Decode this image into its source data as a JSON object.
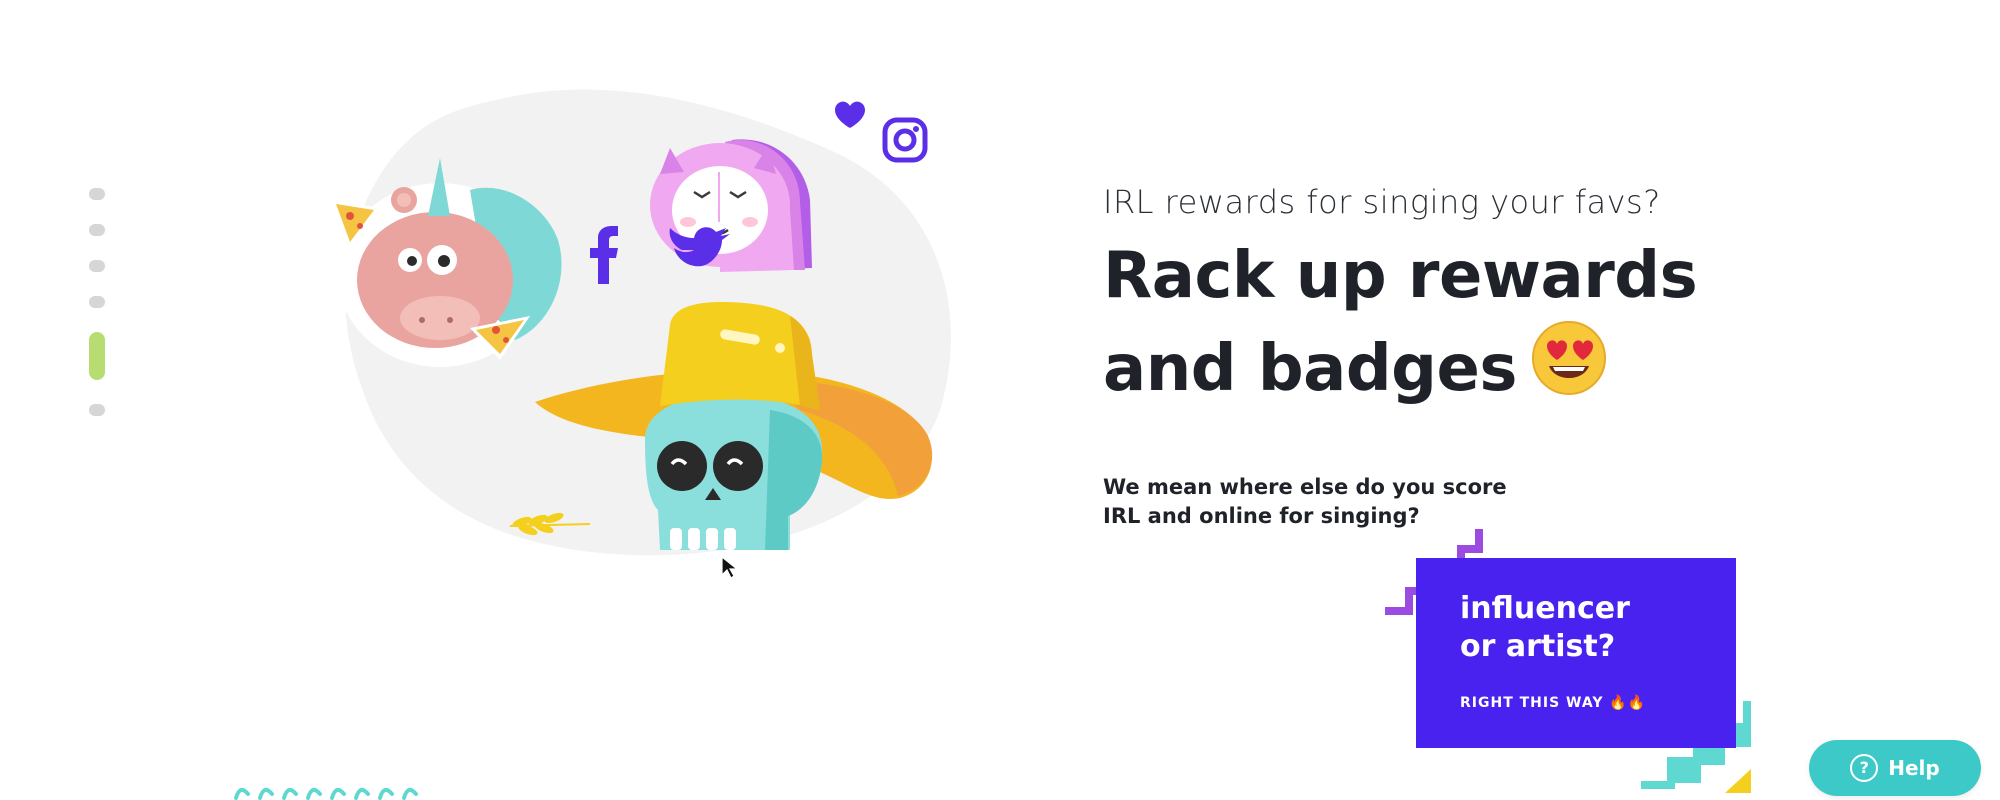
{
  "hero": {
    "kicker": "IRL rewards for singing your favs?",
    "headline_line1": "Rack up rewards",
    "headline_line2": "and badges",
    "headline_emoji": "heart-eyes-emoji",
    "body_line1": "We mean where else do you score",
    "body_line2": "IRL and online for singing?"
  },
  "slide_nav": {
    "count": 6,
    "active_index": 4
  },
  "cta": {
    "title_line1": "influencer",
    "title_line2": "or artist?",
    "link_label": "RIGHT THIS WAY 🔥🔥"
  },
  "help": {
    "label": "Help",
    "icon": "?"
  },
  "illustration": {
    "stickers": [
      "unicorn-hippo-sticker",
      "pink-yeti-sticker",
      "skull-cowboy-sticker"
    ],
    "social_icons": [
      "heart-icon",
      "instagram-icon",
      "facebook-icon",
      "twitter-icon"
    ]
  },
  "colors": {
    "accent_purple": "#4a22f0",
    "accent_teal": "#3ec9c9",
    "active_dot": "#b6dc72",
    "headline": "#1f2329"
  }
}
